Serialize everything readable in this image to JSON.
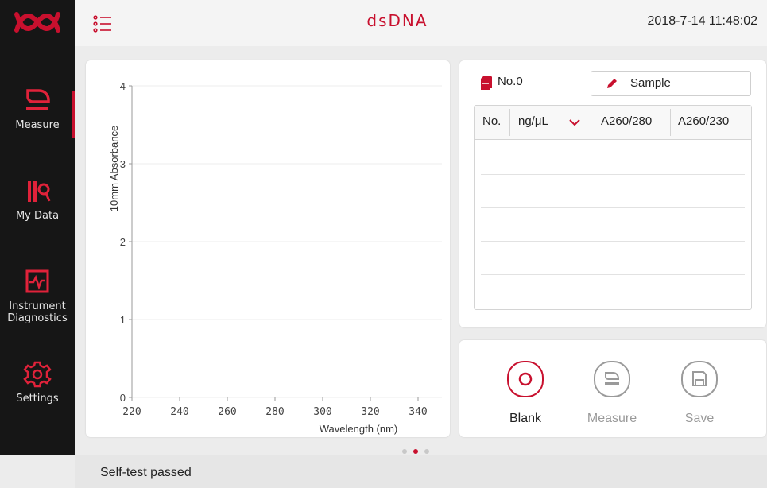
{
  "header": {
    "logo_icon": "brand-logo-icon",
    "menu_icon": "list-menu-icon",
    "title": "dsDNA",
    "datetime": "2018-7-14  11:48:02"
  },
  "sidebar": {
    "items": [
      {
        "label": "Measure",
        "icon": "measure-icon",
        "active": true
      },
      {
        "label": "My Data",
        "icon": "my-data-icon",
        "active": false
      },
      {
        "label1": "Instrument",
        "label2": "Diagnostics",
        "icon": "diagnostics-icon",
        "active": false
      },
      {
        "label": "Settings",
        "icon": "settings-gear-icon",
        "active": false
      }
    ]
  },
  "chart_data": {
    "type": "line",
    "title": "",
    "xlabel": "Wavelength (nm)",
    "ylabel": "10mm Absorbance",
    "xlim": [
      220,
      350
    ],
    "ylim": [
      0,
      4
    ],
    "xticks": [
      220,
      240,
      260,
      280,
      300,
      320,
      340
    ],
    "yticks": [
      0,
      1,
      2,
      3,
      4
    ],
    "grid": true,
    "series": []
  },
  "sample_panel": {
    "number_label": "No.0",
    "sample_button": "Sample",
    "table": {
      "headers": [
        "No.",
        "ng/μL",
        "A260/280",
        "A260/230"
      ],
      "rows": []
    }
  },
  "actions": {
    "blank": "Blank",
    "measure": "Measure",
    "save": "Save"
  },
  "pager": {
    "count": 3,
    "active": 2
  },
  "status": {
    "message": "Self-test passed"
  },
  "colors": {
    "accent": "#c8102e",
    "disabled": "#9a9a9a",
    "sidebar": "#161616"
  }
}
